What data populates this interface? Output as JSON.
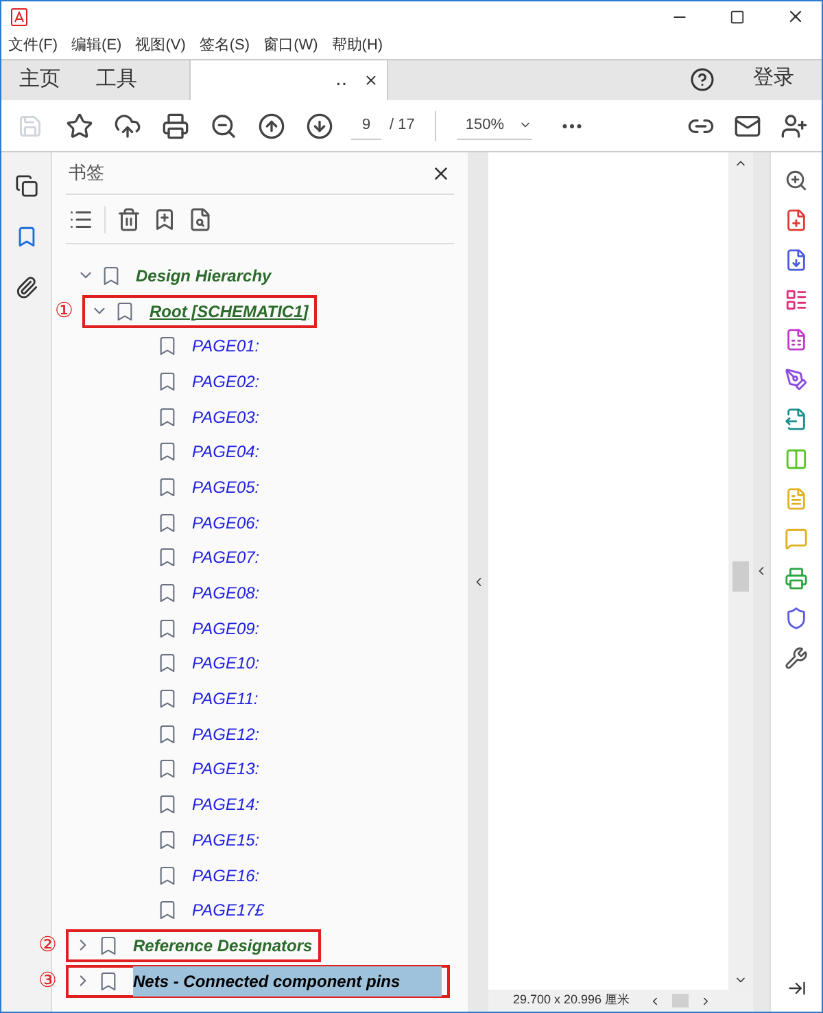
{
  "menu": [
    "文件(F)",
    "编辑(E)",
    "视图(V)",
    "签名(S)",
    "窗口(W)",
    "帮助(H)"
  ],
  "tabs": [
    {
      "label": "主页",
      "selected": false
    },
    {
      "label": "工具",
      "selected": false
    },
    {
      "label": "..",
      "selected": true
    }
  ],
  "signin": "登录",
  "toolbar": {
    "page": "9",
    "total": "/ 17",
    "zoom": "150%"
  },
  "panel": {
    "title": "书签"
  },
  "bookmarks": [
    {
      "label": "Design Hierarchy",
      "expanded": true,
      "selected": false,
      "kind": "group",
      "children": [
        {
          "label": "Root [SCHEMATIC1]",
          "expanded": true,
          "selected": false,
          "kind": "root",
          "marker": "①",
          "children": [
            {
              "label": "PAGE01:"
            },
            {
              "label": "PAGE02:"
            },
            {
              "label": "PAGE03:"
            },
            {
              "label": "PAGE04:"
            },
            {
              "label": "PAGE05:"
            },
            {
              "label": "PAGE06:"
            },
            {
              "label": "PAGE07:"
            },
            {
              "label": "PAGE08:"
            },
            {
              "label": "PAGE09:"
            },
            {
              "label": "PAGE10:"
            },
            {
              "label": "PAGE11:"
            },
            {
              "label": "PAGE12:"
            },
            {
              "label": "PAGE13:"
            },
            {
              "label": "PAGE14:"
            },
            {
              "label": "PAGE15:"
            },
            {
              "label": "PAGE16:"
            },
            {
              "label": "PAGE17£"
            }
          ]
        }
      ]
    },
    {
      "label": "Reference Designators",
      "expanded": false,
      "selected": false,
      "kind": "group",
      "marker": "②"
    },
    {
      "label": "Nets - Connected component pins",
      "expanded": false,
      "selected": true,
      "kind": "plain",
      "marker": "③"
    }
  ],
  "status": "29.700 x 20.996 厘米"
}
